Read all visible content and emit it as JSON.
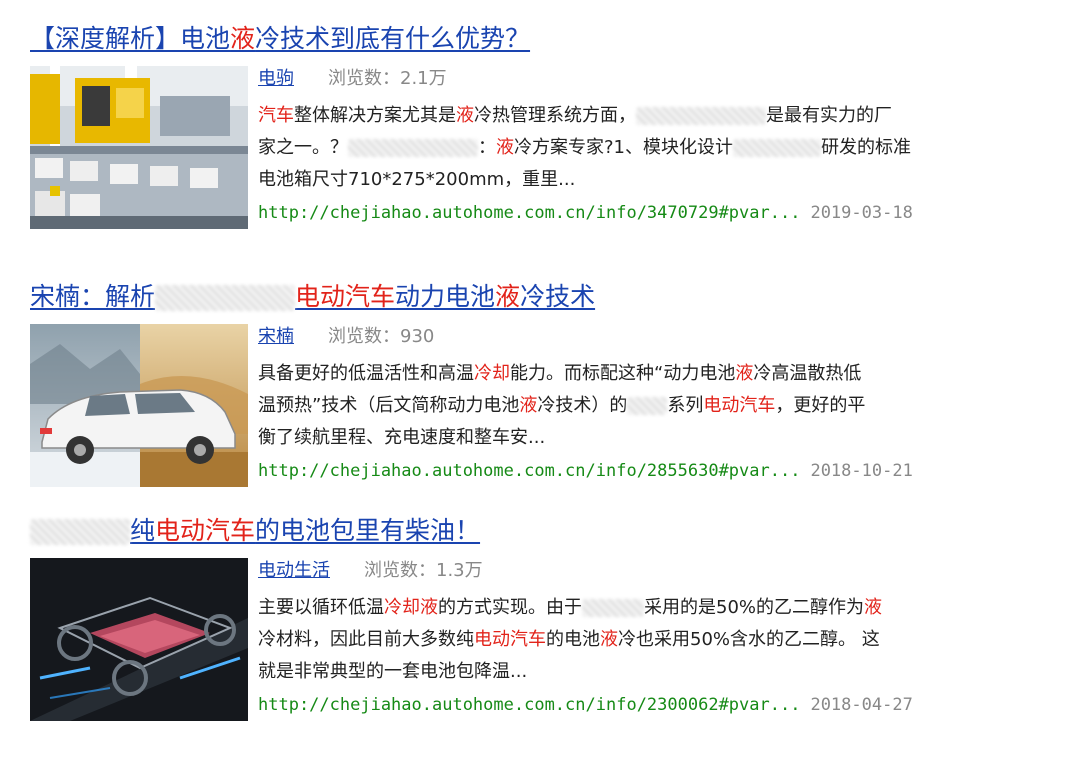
{
  "results": [
    {
      "title_parts": [
        {
          "t": "【深度解析】电池"
        },
        {
          "t": "液",
          "hl": true
        },
        {
          "t": "冷技术到底有什么优势？"
        }
      ],
      "author": "电驹",
      "views_label": "浏览数：",
      "views_value": "2.1万",
      "snippet_lines": [
        [
          {
            "t": "汽车",
            "hl": true
          },
          {
            "t": "整体解决方案尤其是"
          },
          {
            "t": "液",
            "hl": true
          },
          {
            "t": "冷热管理系统方面，"
          },
          {
            "blur": 130
          },
          {
            "t": "是最有实力的厂"
          }
        ],
        [
          {
            "t": "家之一。？"
          },
          {
            "blur": 130
          },
          {
            "t": "："
          },
          {
            "t": "液",
            "hl": true
          },
          {
            "t": "冷方案专家?1、模块化设计"
          },
          {
            "blur": 88
          },
          {
            "t": "研发的标准"
          }
        ],
        [
          {
            "t": "电池箱尺寸710*275*200mm，重里..."
          }
        ]
      ],
      "url": "http://chejiahao.autohome.com.cn/info/3470729#pvar...",
      "date": "2019-03-18"
    },
    {
      "title_parts": [
        {
          "t": "宋楠：解析"
        },
        {
          "blur": 140
        },
        {
          "t": "电动汽车",
          "hl": true
        },
        {
          "t": "动力电池"
        },
        {
          "t": "液",
          "hl": true
        },
        {
          "t": "冷技术"
        }
      ],
      "author": "宋楠",
      "views_label": "浏览数：",
      "views_value": "930",
      "snippet_lines": [
        [
          {
            "t": "具备更好的低温活性和高温"
          },
          {
            "t": "冷却",
            "hl": true
          },
          {
            "t": "能力。而标配这种“动力电池"
          },
          {
            "t": "液",
            "hl": true
          },
          {
            "t": "冷高温散热低"
          }
        ],
        [
          {
            "t": "温预热”技术（后文简称动力电池"
          },
          {
            "t": "液",
            "hl": true
          },
          {
            "t": "冷技术）的"
          },
          {
            "blur": 40
          },
          {
            "t": "系列"
          },
          {
            "t": "电动汽车",
            "hl": true
          },
          {
            "t": "，更好的平"
          }
        ],
        [
          {
            "t": "衡了续航里程、充电速度和整车安..."
          }
        ]
      ],
      "url": "http://chejiahao.autohome.com.cn/info/2855630#pvar...",
      "date": "2018-10-21"
    },
    {
      "title_parts": [
        {
          "blur": 100
        },
        {
          "t": "纯"
        },
        {
          "t": "电动汽车",
          "hl": true
        },
        {
          "t": "的电池包里有柴油！"
        }
      ],
      "author": "电动生活",
      "views_label": "浏览数：",
      "views_value": "1.3万",
      "snippet_lines": [
        [
          {
            "t": "主要以循环低温"
          },
          {
            "t": "冷却液",
            "hl": true
          },
          {
            "t": "的方式实现。由于"
          },
          {
            "blur": 62
          },
          {
            "t": "采用的是50%的乙二醇作为"
          },
          {
            "t": "液",
            "hl": true
          }
        ],
        [
          {
            "t": "冷材料，因此目前大多数纯"
          },
          {
            "t": "电动汽车",
            "hl": true
          },
          {
            "t": "的电池"
          },
          {
            "t": "液",
            "hl": true
          },
          {
            "t": "冷也采用50%含水的乙二醇。 这"
          }
        ],
        [
          {
            "t": "就是非常典型的一套电池包降温..."
          }
        ]
      ],
      "url": "http://chejiahao.autohome.com.cn/info/2300062#pvar...",
      "date": "2018-04-27"
    }
  ]
}
